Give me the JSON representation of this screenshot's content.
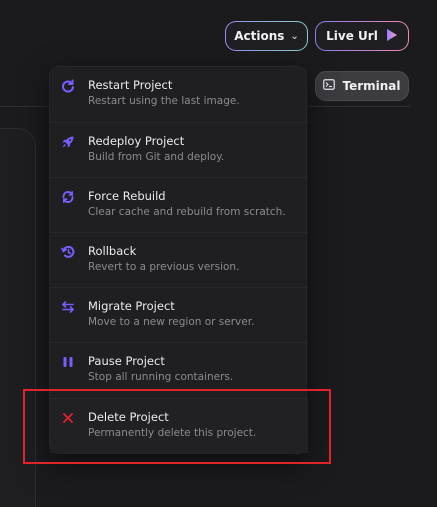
{
  "header": {
    "actions_label": "Actions",
    "live_url_label": "Live Url",
    "terminal_label": "Terminal"
  },
  "menu": {
    "items": [
      {
        "title": "Restart Project",
        "desc": "Restart using the last image.",
        "icon": "restart-icon"
      },
      {
        "title": "Redeploy Project",
        "desc": "Build from Git and deploy.",
        "icon": "rocket-icon"
      },
      {
        "title": "Force Rebuild",
        "desc": "Clear cache and rebuild from scratch.",
        "icon": "rebuild-icon"
      },
      {
        "title": "Rollback",
        "desc": "Revert to a previous version.",
        "icon": "history-icon"
      },
      {
        "title": "Migrate Project",
        "desc": "Move to a new region or server.",
        "icon": "swap-arrows-icon"
      },
      {
        "title": "Pause Project",
        "desc": "Stop all running containers.",
        "icon": "pause-icon"
      },
      {
        "title": "Delete Project",
        "desc": "Permanently delete this project.",
        "icon": "close-icon"
      }
    ]
  },
  "colors": {
    "accent": "#7b5cff",
    "danger": "#e0242b",
    "menu_bg": "#1f1f22"
  }
}
